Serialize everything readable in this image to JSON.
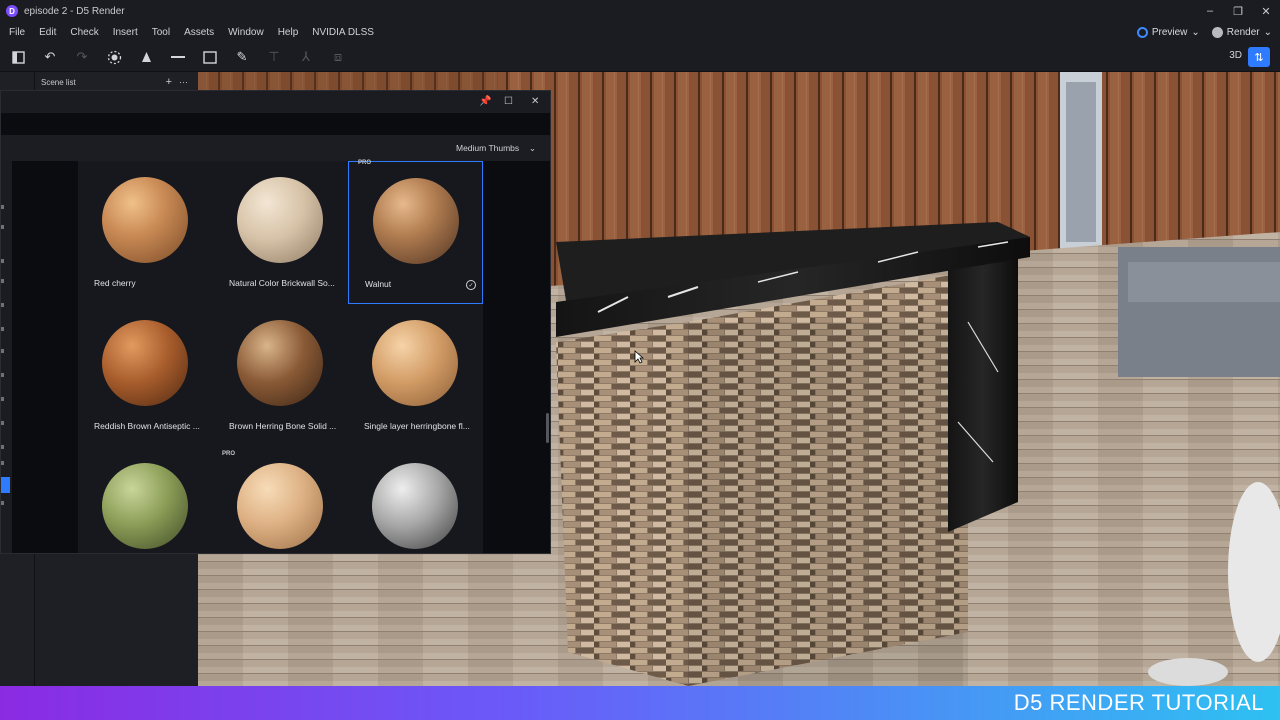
{
  "window": {
    "title": "episode 2 - D5 Render",
    "logo_letter": "D",
    "controls": [
      "–",
      "❐",
      "✕"
    ]
  },
  "menu": {
    "items": [
      "File",
      "Edit",
      "Check",
      "Insert",
      "Tool",
      "Assets",
      "Window",
      "Help",
      "NVIDIA DLSS"
    ],
    "preview_label": "Preview",
    "render_label": "Render"
  },
  "toolbar": {
    "view_mode": "3D"
  },
  "scene": {
    "list_label": "Scene list"
  },
  "material_panel": {
    "thumb_size": "Medium Thumbs",
    "materials": [
      {
        "name": "Red cherry",
        "pro": false,
        "selected": false
      },
      {
        "name": "Natural Color Brickwall So...",
        "pro": false,
        "selected": false
      },
      {
        "name": "Walnut",
        "pro": true,
        "selected": true
      },
      {
        "name": "Reddish Brown Antiseptic ...",
        "pro": false,
        "selected": false
      },
      {
        "name": "Brown Herring Bone Solid ...",
        "pro": false,
        "selected": false
      },
      {
        "name": "Single layer herringbone fl...",
        "pro": false,
        "selected": false
      },
      {
        "name": "",
        "pro": false,
        "selected": false
      },
      {
        "name": "",
        "pro": true,
        "selected": false
      },
      {
        "name": "",
        "pro": false,
        "selected": false
      }
    ],
    "pro_badge": "PRO"
  },
  "banner": {
    "text": "D5 RENDER TUTORIAL"
  },
  "colors": {
    "accent": "#2f7bff",
    "brand": "#7c4dff",
    "banner_start": "#8a2be2",
    "banner_end": "#2ec1f2"
  }
}
